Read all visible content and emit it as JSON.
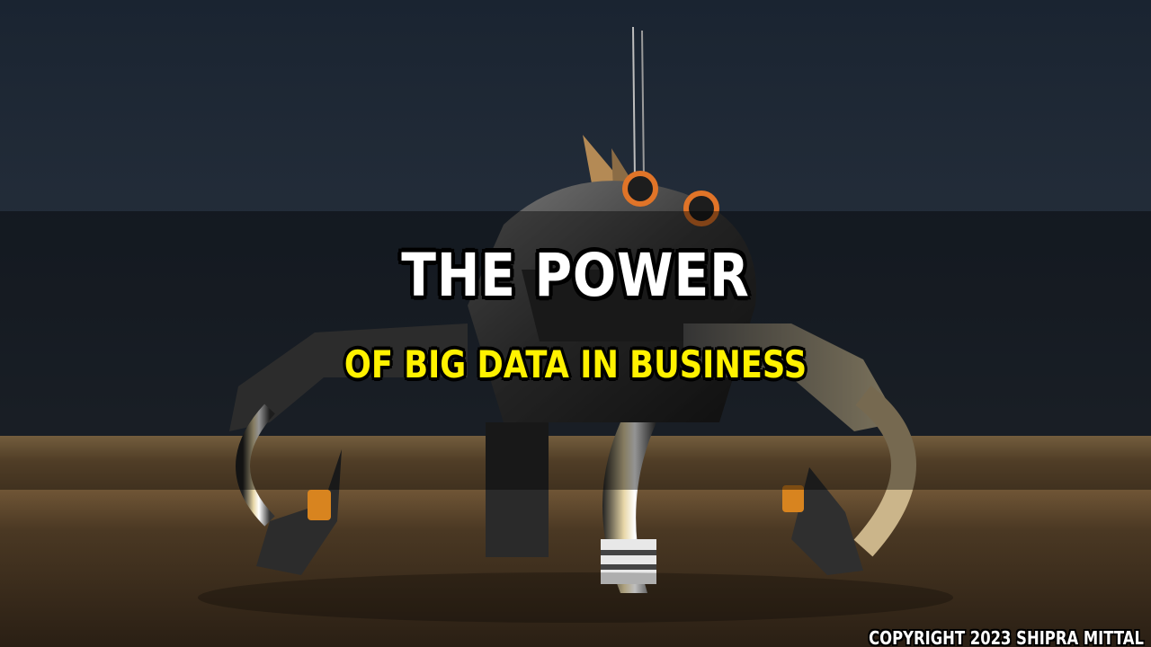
{
  "image": {
    "subject": "robot-crab-illustration",
    "colors": {
      "sky": "#1c2733",
      "horizon_glow": "#c9a36a",
      "ground": "#3a2c1c",
      "robot_metal": "#4a4a4a",
      "accent_orange": "#d8641f"
    }
  },
  "headline": {
    "main": "THE POWER",
    "sub": "OF BIG DATA IN BUSINESS",
    "main_color": "#ffffff",
    "sub_color": "#fff200"
  },
  "footer": {
    "copyright": "COPYRIGHT 2023 SHIPRA MITTAL"
  }
}
